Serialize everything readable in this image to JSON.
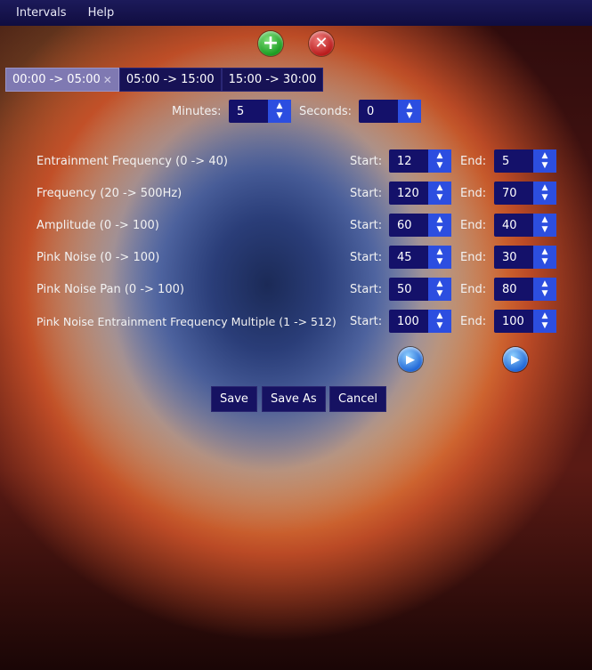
{
  "menu": {
    "intervals": "Intervals",
    "help": "Help"
  },
  "icons": {
    "add": "plus-icon",
    "remove": "x-icon",
    "play": "play-icon"
  },
  "tabs": [
    {
      "label": "00:00 -> 05:00",
      "close": "✕"
    },
    {
      "label": "05:00 -> 15:00"
    },
    {
      "label": "15:00 -> 30:00"
    }
  ],
  "duration": {
    "minutes_label": "Minutes:",
    "minutes_value": "5",
    "seconds_label": "Seconds:",
    "seconds_value": "0"
  },
  "params": [
    {
      "label": "Entrainment Frequency (0 -> 40)",
      "start": "12",
      "end": "5"
    },
    {
      "label": "Frequency (20 -> 500Hz)",
      "start": "120",
      "end": "70"
    },
    {
      "label": "Amplitude (0 -> 100)",
      "start": "60",
      "end": "40"
    },
    {
      "label": "Pink Noise (0 -> 100)",
      "start": "45",
      "end": "30"
    },
    {
      "label": "Pink Noise Pan (0 -> 100)",
      "start": "50",
      "end": "80"
    },
    {
      "label": "Pink Noise Entrainment Frequency Multiple (1 -> 512)",
      "start": "100",
      "end": "100"
    }
  ],
  "start_label": "Start:",
  "end_label": "End:",
  "buttons": {
    "save": "Save",
    "save_as": "Save As",
    "cancel": "Cancel"
  },
  "colors": {
    "menubar": "#100d40",
    "spinner_arrow": "#2c4ee0",
    "tab_active": "#7f79b2"
  }
}
